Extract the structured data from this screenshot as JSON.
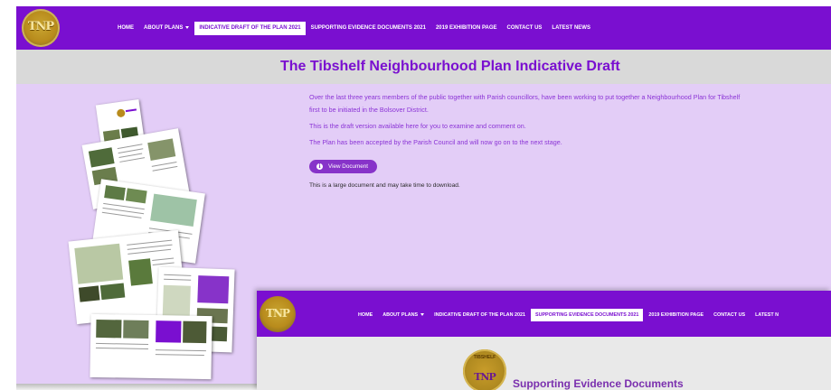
{
  "main": {
    "logo_text": "TNP",
    "nav": [
      {
        "label": "HOME"
      },
      {
        "label": "ABOUT PLANS"
      },
      {
        "label": "INDICATIVE DRAFT OF THE PLAN 2021",
        "active": true
      },
      {
        "label": "SUPPORTING EVIDENCE DOCUMENTS 2021"
      },
      {
        "label": "2019 EXHIBITION PAGE"
      },
      {
        "label": "CONTACT US"
      },
      {
        "label": "LATEST NEWS"
      }
    ],
    "page_title": "The Tibshelf Neighbourhood Plan Indicative Draft",
    "paragraph_1_line_1": "Over the last three years members of the public together with Parish councillors, have been working to put together a Neighbourhood Plan for Tibshelf",
    "paragraph_1_line_2": "first to be initiated in the Bolsover District.",
    "paragraph_2": "This is the draft version available here for you to examine and comment on.",
    "paragraph_3": "The Plan has been accepted by the Parish Council and will now go on to the next stage.",
    "view_button_label": "View Document",
    "view_button_icon": "info-icon",
    "download_note": "This is a large document and may take time to download."
  },
  "secondary_window": {
    "logo_text": "TNP",
    "nav": [
      {
        "label": "HOME"
      },
      {
        "label": "ABOUT PLANS"
      },
      {
        "label": "INDICATIVE DRAFT OF THE PLAN 2021"
      },
      {
        "label": "SUPPORTING EVIDENCE DOCUMENTS 2021",
        "active": true
      },
      {
        "label": "2019 EXHIBITION PAGE"
      },
      {
        "label": "CONTACT US"
      },
      {
        "label": "LATEST N"
      }
    ],
    "seal_top_text": "TIBSHELF",
    "seal_text": "TNP",
    "heading": "Supporting Evidence Documents"
  },
  "colors": {
    "brand_purple": "#7a0fd0",
    "content_background": "#e3cdf7",
    "title_band": "#d9d9d9",
    "button": "#8733c9",
    "logo_gold": "#b88b1c"
  }
}
